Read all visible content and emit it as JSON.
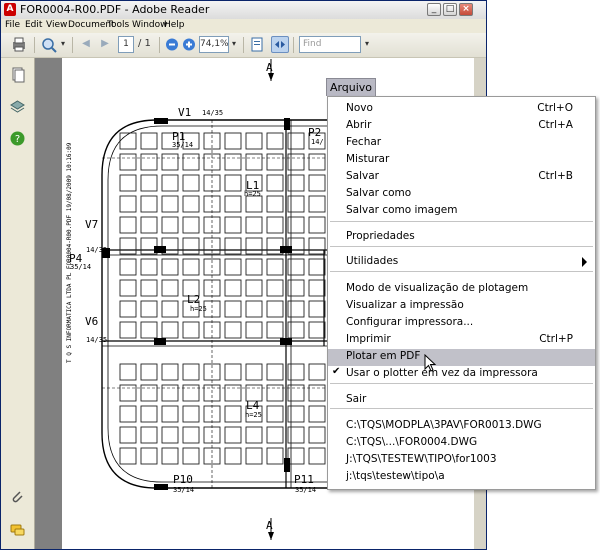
{
  "window": {
    "title": "FOR0004-R00.PDF - Adobe Reader",
    "app_icon": "pdf-icon",
    "controls": [
      "minimize-icon",
      "maximize-icon",
      "close-icon"
    ]
  },
  "menubar": {
    "items": [
      "File",
      "Edit",
      "View",
      "Document",
      "Tools",
      "Window",
      "Help"
    ]
  },
  "toolbar": {
    "page_current": "1",
    "page_total": "/ 1",
    "zoom": "74,1%",
    "find_placeholder": "Find"
  },
  "drawing": {
    "labels": [
      {
        "text": "A",
        "cls": "big"
      },
      {
        "text": "V1",
        "cls": "big"
      },
      {
        "text": "14/35",
        "cls": "small"
      },
      {
        "text": "P1",
        "cls": "big"
      },
      {
        "text": "35/14",
        "cls": "small"
      },
      {
        "text": "P2",
        "cls": "big"
      },
      {
        "text": "14/",
        "cls": "small"
      },
      {
        "text": "L1",
        "cls": "big"
      },
      {
        "text": "h=25",
        "cls": "small"
      },
      {
        "text": "V7",
        "cls": "big"
      },
      {
        "text": "14/35",
        "cls": "small"
      },
      {
        "text": "P4",
        "cls": "big"
      },
      {
        "text": "35/14",
        "cls": "small"
      },
      {
        "text": "L2",
        "cls": "big"
      },
      {
        "text": "h=25",
        "cls": "small"
      },
      {
        "text": "V6",
        "cls": "big"
      },
      {
        "text": "14/35",
        "cls": "small"
      },
      {
        "text": "L4",
        "cls": "big"
      },
      {
        "text": "h=25",
        "cls": "small"
      },
      {
        "text": "P10",
        "cls": "big"
      },
      {
        "text": "35/14",
        "cls": "small"
      },
      {
        "text": "P11",
        "cls": "big"
      },
      {
        "text": "35/14",
        "cls": "small"
      },
      {
        "text": "A",
        "cls": "big"
      }
    ],
    "side_text": "T Q S  INFORMATICA LTDA PL FOR0004-R00.PDF 19/08/2009 10:16:09"
  },
  "menu": {
    "tab": "Arquivo",
    "items": [
      {
        "label": "Novo",
        "shortcut": "Ctrl+O"
      },
      {
        "label": "Abrir",
        "shortcut": "Ctrl+A"
      },
      {
        "label": "Fechar",
        "shortcut": ""
      },
      {
        "label": "Misturar",
        "shortcut": ""
      },
      {
        "label": "Salvar",
        "shortcut": "Ctrl+B"
      },
      {
        "label": "Salvar como",
        "shortcut": ""
      },
      {
        "label": "Salvar como imagem",
        "shortcut": ""
      },
      {
        "label": "Propriedades",
        "shortcut": ""
      },
      {
        "label": "Utilidades",
        "shortcut": "",
        "submenu": true
      },
      {
        "label": "Modo de visualização de plotagem",
        "shortcut": ""
      },
      {
        "label": "Visualizar a impressão",
        "shortcut": ""
      },
      {
        "label": "Configurar impressora...",
        "shortcut": ""
      },
      {
        "label": "Imprimir",
        "shortcut": "Ctrl+P"
      },
      {
        "label": "Plotar em PDF",
        "shortcut": "",
        "highlighted": true
      },
      {
        "label": "Usar o plotter em vez da impressora",
        "shortcut": "",
        "checked": true
      },
      {
        "label": "Sair",
        "shortcut": ""
      },
      {
        "label": "C:\\TQS\\MODPLA\\3PAV\\FOR0013.DWG",
        "shortcut": ""
      },
      {
        "label": "C:\\TQS\\...\\FOR0004.DWG",
        "shortcut": ""
      },
      {
        "label": "J:\\TQS\\TESTEW\\TIPO\\for1003",
        "shortcut": ""
      },
      {
        "label": "j:\\tqs\\testew\\tipo\\a",
        "shortcut": ""
      }
    ]
  }
}
